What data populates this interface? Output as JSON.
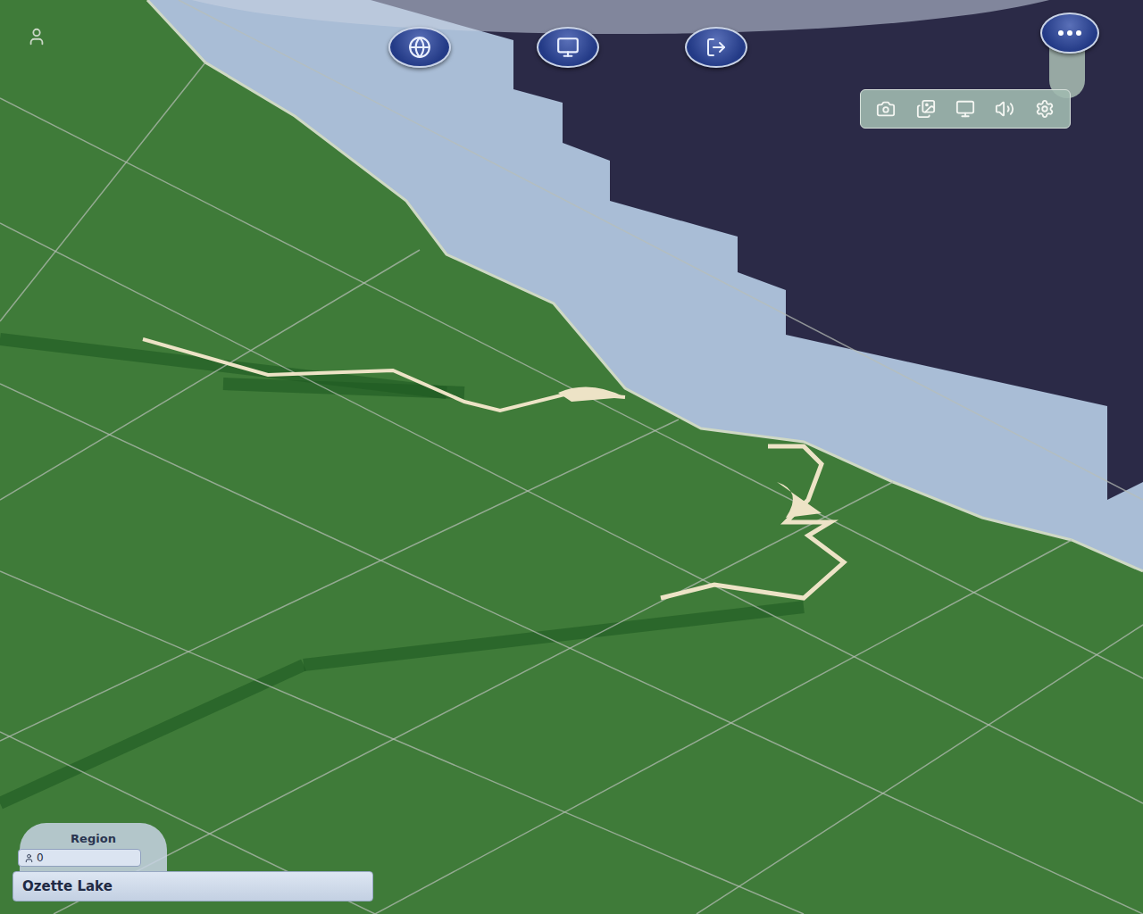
{
  "top_bar": {
    "options_menu": {
      "expanded": true
    }
  },
  "region_panel": {
    "label": "Region",
    "population": "0",
    "name": "Ozette Lake"
  }
}
